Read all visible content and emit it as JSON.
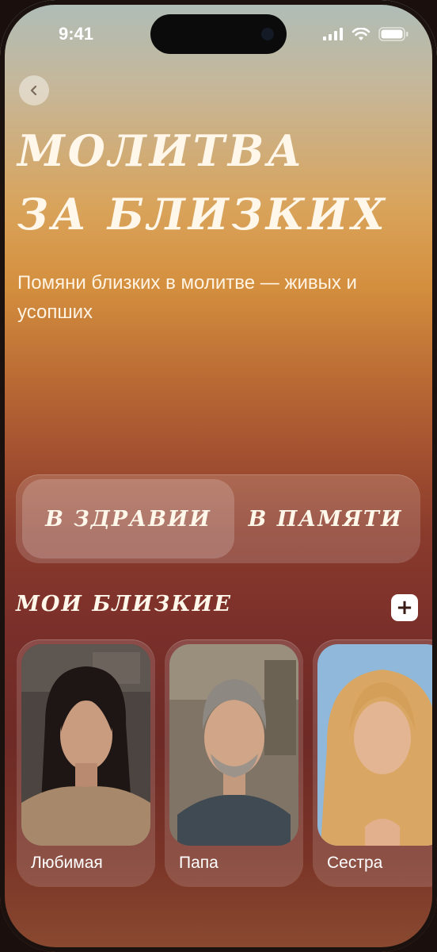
{
  "status_bar": {
    "time": "9:41"
  },
  "header": {
    "title_line1": "МОЛИТВА",
    "title_line2": "ЗА БЛИЗКИХ",
    "subtitle": "Помяни близких в молитве — живых и усопших"
  },
  "segmented": {
    "options": [
      "В ЗДРАВИИ",
      "В ПАМЯТИ"
    ],
    "selected": "В ЗДРАВИИ"
  },
  "loved_ones": {
    "title": "МОИ БЛИЗКИЕ",
    "add_label": "+",
    "items": [
      {
        "name": "Любимая"
      },
      {
        "name": "Папа"
      },
      {
        "name": "Сестра"
      }
    ]
  },
  "colors": {
    "text_light": "#fff7ea",
    "gradient_top": "#aebdb8",
    "gradient_mid": "#d48f3e",
    "gradient_bottom": "#7a2f2a"
  }
}
